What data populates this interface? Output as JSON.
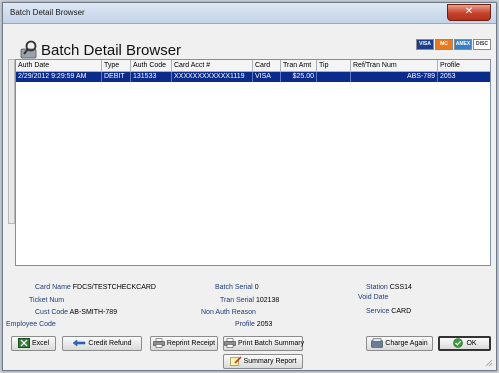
{
  "window": {
    "title": "Batch Detail Browser",
    "close_label": "✕"
  },
  "header": {
    "title": "Batch Detail Browser"
  },
  "card_logos": [
    {
      "label": "VISA",
      "bg": "#1a3e8c",
      "fg": "#ffffff"
    },
    {
      "label": "MC",
      "bg": "#e8791e",
      "fg": "#ffffff"
    },
    {
      "label": "AMEX",
      "bg": "#3b7dc4",
      "fg": "#ffffff"
    },
    {
      "label": "DISC",
      "bg": "#ffffff",
      "fg": "#333333"
    }
  ],
  "grid": {
    "columns": [
      "Auth Date",
      "Type",
      "Auth Code",
      "Card Acct #",
      "Card",
      "Tran Amt",
      "Tip",
      "Ref/Tran Num",
      "Profile"
    ],
    "rows": [
      {
        "auth_date": "2/29/2012 9:29:59 AM",
        "type": "DEBIT",
        "auth_code": "131533",
        "card_acct": "XXXXXXXXXXXX1119",
        "card": "VISA",
        "tran_amt": "$25.00",
        "tip": "",
        "ref_tran_num": "ABS-789",
        "profile": "2053"
      }
    ],
    "selected_color": "#0a2a8c"
  },
  "details": {
    "card_name": {
      "label": "Card Name",
      "value": "FDCS/TESTCHECKCARD"
    },
    "ticket_num": {
      "label": "Ticket Num",
      "value": ""
    },
    "cust_code": {
      "label": "Cust Code",
      "value": "AB-SMITH-789"
    },
    "employee_code": {
      "label": "Employee Code",
      "value": ""
    },
    "batch_serial": {
      "label": "Batch Serial",
      "value": "0"
    },
    "tran_serial": {
      "label": "Tran Serial",
      "value": "102138"
    },
    "non_auth_reason": {
      "label": "Non Auth Reason",
      "value": ""
    },
    "profile": {
      "label": "Profile",
      "value": "2053"
    },
    "station": {
      "label": "Station",
      "value": "CSS14"
    },
    "void_date": {
      "label": "Void Date",
      "value": ""
    },
    "service": {
      "label": "Service",
      "value": "CARD"
    }
  },
  "buttons": {
    "excel": "Excel",
    "credit_refund": "Credit Refund",
    "reprint_receipt": "Reprint Receipt",
    "print_batch_summary": "Print Batch Summary",
    "summary_report": "Summary Report",
    "charge_again": "Charge Again",
    "ok": "OK"
  }
}
